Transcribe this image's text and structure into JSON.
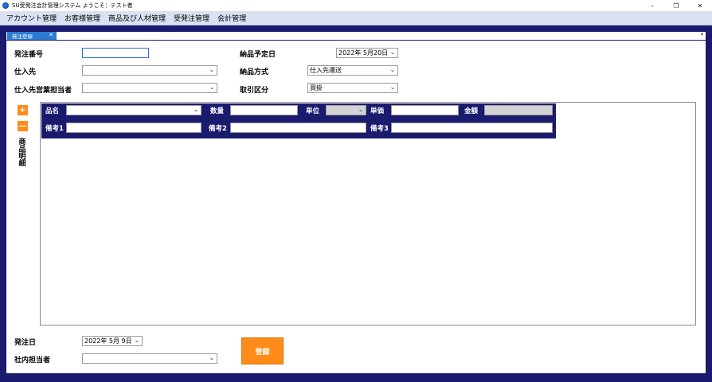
{
  "window": {
    "title": "SU受発注会計管理システム ようこそ：テスト者",
    "minimize": "–",
    "maximize": "❐",
    "close": "✕"
  },
  "menu": {
    "items": [
      "アカウント管理",
      "お客様管理",
      "商品及び人材管理",
      "受発注管理",
      "会計管理"
    ]
  },
  "tab": {
    "label": "発注登録",
    "close": "✕",
    "overflow": "▾"
  },
  "form": {
    "order_no_label": "発注番号",
    "order_no_value": "",
    "supplier_label": "仕入先",
    "supplier_value": "",
    "supplier_rep_label": "仕入先営業担当者",
    "supplier_rep_value": "",
    "delivery_date_label": "納品予定日",
    "delivery_date_value": "2022年 5月20日",
    "delivery_method_label": "納品方式",
    "delivery_method_value": "仕入先運送",
    "trade_type_label": "取引区分",
    "trade_type_value": "買掛",
    "order_date_label": "発注日",
    "order_date_value": "2022年 5月 9日",
    "staff_label": "社内担当者",
    "staff_value": "",
    "submit_label": "登録"
  },
  "detail": {
    "section_label": "商品明細",
    "add_label": "+",
    "remove_label": "—",
    "product_label": "品名",
    "qty_label": "数量",
    "unit_label": "単位",
    "price_label": "単価",
    "amount_label": "金額",
    "note1_label": "備考1",
    "note2_label": "備考2",
    "note3_label": "備考3"
  },
  "icons": {
    "dropdown": "⌄"
  },
  "colors": {
    "accent": "#ff8c1a",
    "frame": "#1a1a6e",
    "tab": "#2b7bd3",
    "menubar": "#d9e1f2"
  }
}
